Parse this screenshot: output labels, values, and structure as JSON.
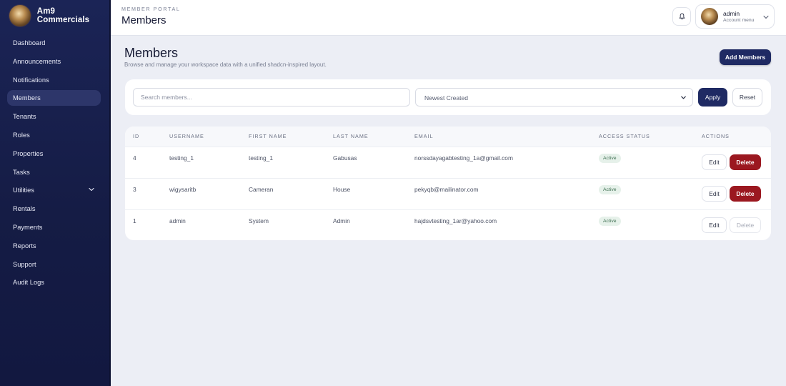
{
  "brand": {
    "name": "Am9 Commercials"
  },
  "sidebar": {
    "items": [
      {
        "label": "Dashboard"
      },
      {
        "label": "Announcements"
      },
      {
        "label": "Notifications"
      },
      {
        "label": "Members",
        "active": true
      },
      {
        "label": "Tenants"
      },
      {
        "label": "Roles"
      },
      {
        "label": "Properties"
      },
      {
        "label": "Tasks"
      },
      {
        "label": "Utilities",
        "expandable": true
      },
      {
        "label": "Rentals"
      },
      {
        "label": "Payments"
      },
      {
        "label": "Reports"
      },
      {
        "label": "Support"
      },
      {
        "label": "Audit Logs"
      }
    ]
  },
  "topbar": {
    "section_label": "MEMBER PORTAL",
    "title": "Members",
    "notification_icon": "bell-icon",
    "account": {
      "name": "admin",
      "sub": "Account menu"
    }
  },
  "main": {
    "title": "Members",
    "subtitle": "Browse and manage your workspace data with a unified shadcn-inspired layout.",
    "add_button": "Add Members",
    "filters": {
      "search_placeholder": "Search members...",
      "sort_value": "Newest Created",
      "apply_label": "Apply",
      "reset_label": "Reset"
    },
    "table": {
      "columns": [
        "ID",
        "USERNAME",
        "FIRST NAME",
        "LAST NAME",
        "EMAIL",
        "ACCESS STATUS",
        "ACTIONS"
      ],
      "rows": [
        {
          "id": "4",
          "username": "testing_1",
          "first_name": "testing_1",
          "last_name": "Gabusas",
          "email": "norssdayagabtesting_1a@gmail.com",
          "status": "Active",
          "edit": "Edit",
          "delete": "Delete",
          "delete_enabled": true
        },
        {
          "id": "3",
          "username": "wigysaritb",
          "first_name": "Cameran",
          "last_name": "House",
          "email": "pekyqb@mailinator.com",
          "status": "Active",
          "edit": "Edit",
          "delete": "Delete",
          "delete_enabled": true
        },
        {
          "id": "1",
          "username": "admin",
          "first_name": "System",
          "last_name": "Admin",
          "email": "hajdsvtesting_1ar@yahoo.com",
          "status": "Active",
          "edit": "Edit",
          "delete": "Delete",
          "delete_enabled": false
        }
      ]
    }
  },
  "colors": {
    "sidebar_bg": "#1b2456",
    "primary": "#1f2a63",
    "danger": "#9b1820",
    "active_badge_bg": "#e6f1ea",
    "page_bg": "#eceef5"
  }
}
